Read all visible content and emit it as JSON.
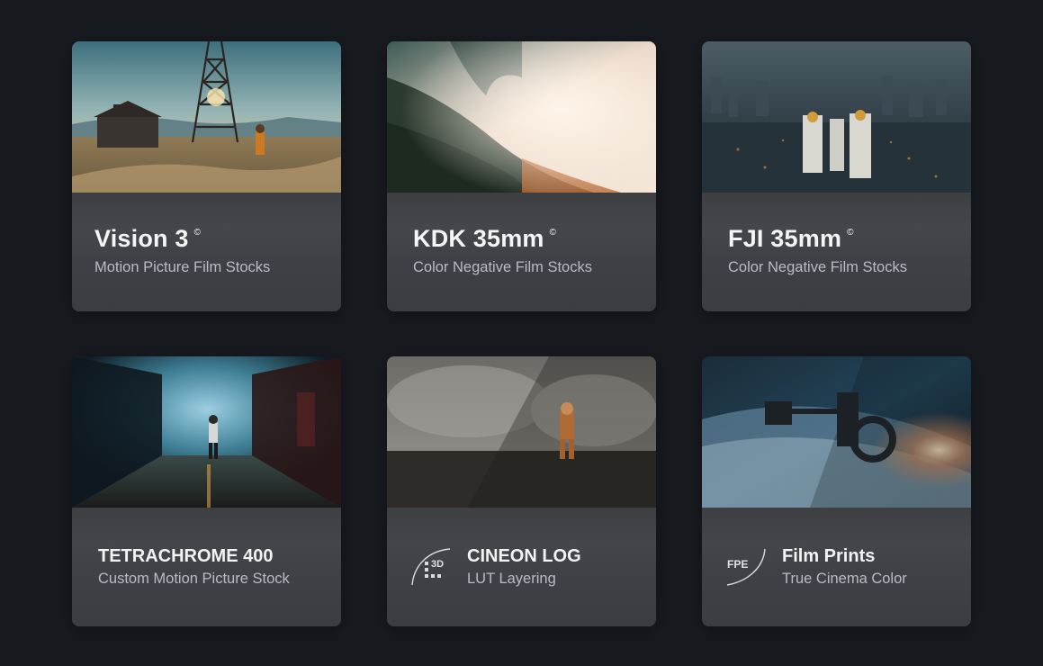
{
  "cards": [
    {
      "title": "Vision 3",
      "mark": "©",
      "subtitle": "Motion Picture Film Stocks"
    },
    {
      "title": "KDK 35mm",
      "mark": "©",
      "subtitle": "Color Negative Film Stocks"
    },
    {
      "title": "FJI 35mm",
      "mark": "©",
      "subtitle": "Color Negative Film Stocks"
    },
    {
      "title": "TETRACHROME 400",
      "subtitle": "Custom Motion Picture Stock"
    },
    {
      "title": "CINEON LOG",
      "subtitle": "LUT Layering",
      "badge": "3D"
    },
    {
      "title": "Film Prints",
      "subtitle": "True Cinema Color",
      "badge": "FPE"
    }
  ],
  "colors": {
    "background": "#171a1f",
    "panel": "#3e4146",
    "title": "#f4f5f7",
    "subtitle": "#b9bcc2"
  }
}
